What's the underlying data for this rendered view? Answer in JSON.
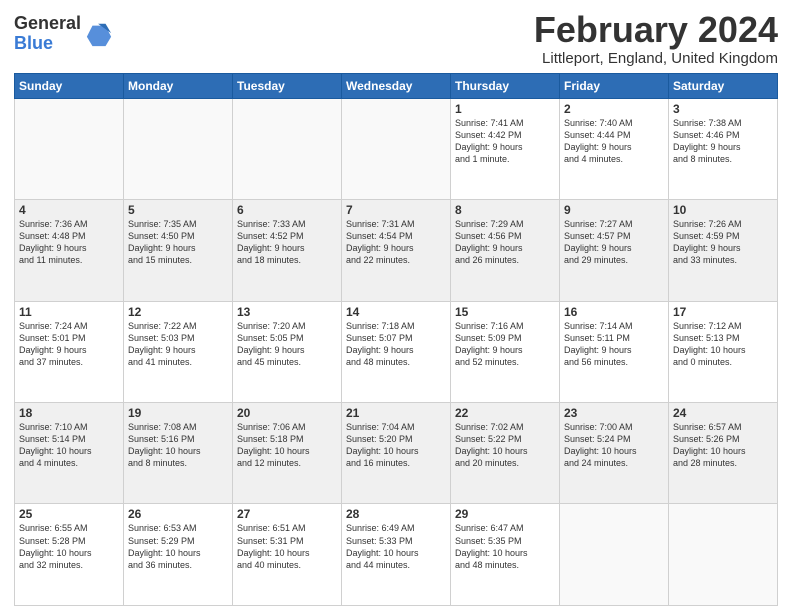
{
  "logo": {
    "general": "General",
    "blue": "Blue"
  },
  "title": "February 2024",
  "subtitle": "Littleport, England, United Kingdom",
  "days": [
    "Sunday",
    "Monday",
    "Tuesday",
    "Wednesday",
    "Thursday",
    "Friday",
    "Saturday"
  ],
  "weeks": [
    [
      {
        "num": "",
        "info": ""
      },
      {
        "num": "",
        "info": ""
      },
      {
        "num": "",
        "info": ""
      },
      {
        "num": "",
        "info": ""
      },
      {
        "num": "1",
        "info": "Sunrise: 7:41 AM\nSunset: 4:42 PM\nDaylight: 9 hours\nand 1 minute."
      },
      {
        "num": "2",
        "info": "Sunrise: 7:40 AM\nSunset: 4:44 PM\nDaylight: 9 hours\nand 4 minutes."
      },
      {
        "num": "3",
        "info": "Sunrise: 7:38 AM\nSunset: 4:46 PM\nDaylight: 9 hours\nand 8 minutes."
      }
    ],
    [
      {
        "num": "4",
        "info": "Sunrise: 7:36 AM\nSunset: 4:48 PM\nDaylight: 9 hours\nand 11 minutes."
      },
      {
        "num": "5",
        "info": "Sunrise: 7:35 AM\nSunset: 4:50 PM\nDaylight: 9 hours\nand 15 minutes."
      },
      {
        "num": "6",
        "info": "Sunrise: 7:33 AM\nSunset: 4:52 PM\nDaylight: 9 hours\nand 18 minutes."
      },
      {
        "num": "7",
        "info": "Sunrise: 7:31 AM\nSunset: 4:54 PM\nDaylight: 9 hours\nand 22 minutes."
      },
      {
        "num": "8",
        "info": "Sunrise: 7:29 AM\nSunset: 4:56 PM\nDaylight: 9 hours\nand 26 minutes."
      },
      {
        "num": "9",
        "info": "Sunrise: 7:27 AM\nSunset: 4:57 PM\nDaylight: 9 hours\nand 29 minutes."
      },
      {
        "num": "10",
        "info": "Sunrise: 7:26 AM\nSunset: 4:59 PM\nDaylight: 9 hours\nand 33 minutes."
      }
    ],
    [
      {
        "num": "11",
        "info": "Sunrise: 7:24 AM\nSunset: 5:01 PM\nDaylight: 9 hours\nand 37 minutes."
      },
      {
        "num": "12",
        "info": "Sunrise: 7:22 AM\nSunset: 5:03 PM\nDaylight: 9 hours\nand 41 minutes."
      },
      {
        "num": "13",
        "info": "Sunrise: 7:20 AM\nSunset: 5:05 PM\nDaylight: 9 hours\nand 45 minutes."
      },
      {
        "num": "14",
        "info": "Sunrise: 7:18 AM\nSunset: 5:07 PM\nDaylight: 9 hours\nand 48 minutes."
      },
      {
        "num": "15",
        "info": "Sunrise: 7:16 AM\nSunset: 5:09 PM\nDaylight: 9 hours\nand 52 minutes."
      },
      {
        "num": "16",
        "info": "Sunrise: 7:14 AM\nSunset: 5:11 PM\nDaylight: 9 hours\nand 56 minutes."
      },
      {
        "num": "17",
        "info": "Sunrise: 7:12 AM\nSunset: 5:13 PM\nDaylight: 10 hours\nand 0 minutes."
      }
    ],
    [
      {
        "num": "18",
        "info": "Sunrise: 7:10 AM\nSunset: 5:14 PM\nDaylight: 10 hours\nand 4 minutes."
      },
      {
        "num": "19",
        "info": "Sunrise: 7:08 AM\nSunset: 5:16 PM\nDaylight: 10 hours\nand 8 minutes."
      },
      {
        "num": "20",
        "info": "Sunrise: 7:06 AM\nSunset: 5:18 PM\nDaylight: 10 hours\nand 12 minutes."
      },
      {
        "num": "21",
        "info": "Sunrise: 7:04 AM\nSunset: 5:20 PM\nDaylight: 10 hours\nand 16 minutes."
      },
      {
        "num": "22",
        "info": "Sunrise: 7:02 AM\nSunset: 5:22 PM\nDaylight: 10 hours\nand 20 minutes."
      },
      {
        "num": "23",
        "info": "Sunrise: 7:00 AM\nSunset: 5:24 PM\nDaylight: 10 hours\nand 24 minutes."
      },
      {
        "num": "24",
        "info": "Sunrise: 6:57 AM\nSunset: 5:26 PM\nDaylight: 10 hours\nand 28 minutes."
      }
    ],
    [
      {
        "num": "25",
        "info": "Sunrise: 6:55 AM\nSunset: 5:28 PM\nDaylight: 10 hours\nand 32 minutes."
      },
      {
        "num": "26",
        "info": "Sunrise: 6:53 AM\nSunset: 5:29 PM\nDaylight: 10 hours\nand 36 minutes."
      },
      {
        "num": "27",
        "info": "Sunrise: 6:51 AM\nSunset: 5:31 PM\nDaylight: 10 hours\nand 40 minutes."
      },
      {
        "num": "28",
        "info": "Sunrise: 6:49 AM\nSunset: 5:33 PM\nDaylight: 10 hours\nand 44 minutes."
      },
      {
        "num": "29",
        "info": "Sunrise: 6:47 AM\nSunset: 5:35 PM\nDaylight: 10 hours\nand 48 minutes."
      },
      {
        "num": "",
        "info": ""
      },
      {
        "num": "",
        "info": ""
      }
    ]
  ]
}
